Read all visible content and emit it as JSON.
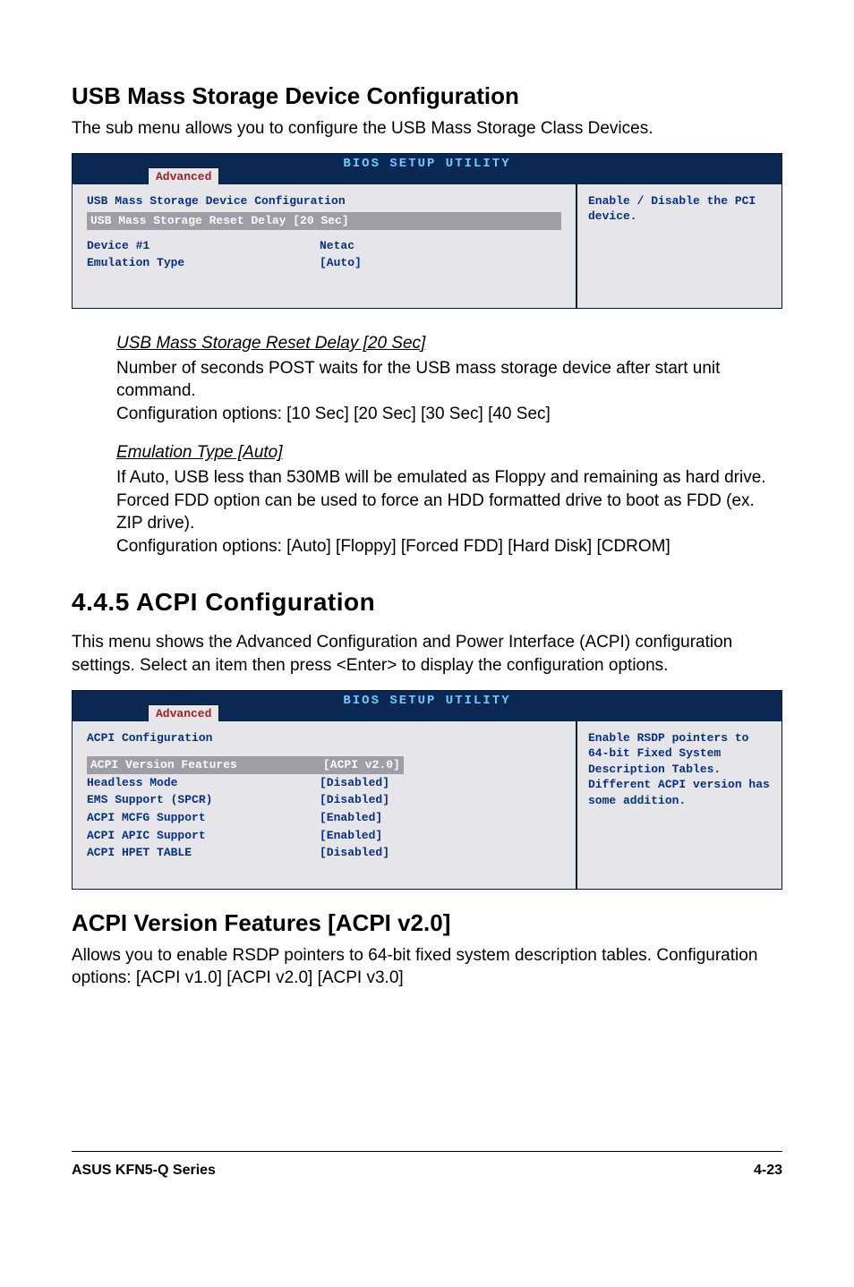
{
  "section1": {
    "title": "USB Mass Storage Device Configuration",
    "intro": "The sub menu allows you to configure the USB  Mass Storage Class Devices."
  },
  "bios1": {
    "header_title": "BIOS SETUP UTILITY",
    "tab": "Advanced",
    "panel_heading": "USB Mass Storage Device Configuration",
    "highlight_row": "USB Mass Storage Reset Delay [20 Sec]",
    "rows": [
      {
        "key": "Device #1",
        "val": "Netac"
      },
      {
        "key": "Emulation Type",
        "val": "[Auto]"
      }
    ],
    "help": "Enable / Disable the PCI device."
  },
  "opts1": {
    "a_heading": "USB Mass Storage Reset Delay [20 Sec]",
    "a_body1": "Number of seconds POST waits for the USB mass storage device after start unit command.",
    "a_body2": "Configuration options: [10 Sec] [20 Sec]  [30 Sec] [40 Sec]",
    "b_heading": "Emulation Type [Auto]",
    "b_body1": "If Auto, USB less than 530MB will be emulated as Floppy and remaining as hard drive. Forced FDD option can be used to force an HDD formatted drive to boot as FDD (ex. ZIP drive).",
    "b_body2": "Configuration options: [Auto] [Floppy] [Forced FDD] [Hard Disk] [CDROM]"
  },
  "section2": {
    "title": "4.4.5    ACPI Configuration",
    "intro": "This menu shows the Advanced Configuration and Power Interface (ACPI) configuration settings. Select an item then press <Enter> to display the configuration options."
  },
  "bios2": {
    "header_title": "BIOS SETUP UTILITY",
    "tab": "Advanced",
    "panel_heading": "ACPI Configuration",
    "highlight_key": "ACPI Version Features",
    "highlight_val": "[ACPI v2.0]",
    "rows": [
      {
        "key": "Headless Mode",
        "val": "[Disabled]"
      },
      {
        "key": "EMS Support (SPCR)",
        "val": "[Disabled]"
      },
      {
        "key": "ACPI MCFG Support",
        "val": "[Enabled]"
      },
      {
        "key": "ACPI APIC Support",
        "val": "[Enabled]"
      },
      {
        "key": "ACPI HPET TABLE",
        "val": "[Disabled]"
      }
    ],
    "help": "Enable RSDP pointers to 64-bit Fixed System Description Tables. Different ACPI version has some addition."
  },
  "section3": {
    "title": "ACPI Version Features [ACPI v2.0]",
    "body": "Allows you to enable RSDP pointers to 64-bit fixed system description tables. Configuration options: [ACPI v1.0] [ACPI v2.0] [ACPI v3.0]"
  },
  "footer": {
    "left": "ASUS KFN5-Q Series",
    "right": "4-23"
  }
}
